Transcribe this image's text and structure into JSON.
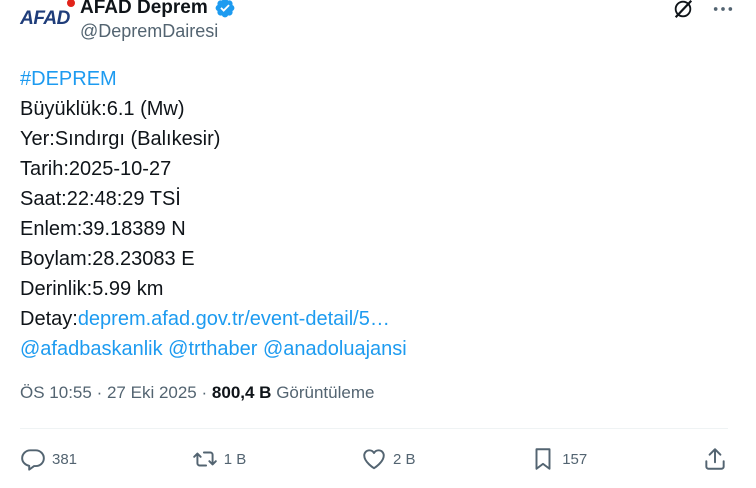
{
  "header": {
    "logo_text": "AFAD",
    "display_name": "AFAD Deprem",
    "handle": "@DepremDairesi"
  },
  "content": {
    "hashtag": "#DEPREM",
    "lines": [
      "Büyüklük:6.1 (Mw)",
      "Yer:Sındırgı (Balıkesir)",
      "Tarih:2025-10-27",
      "Saat:22:48:29 TSİ",
      "Enlem:39.18389 N",
      "Boylam:28.23083 E",
      "Derinlik:5.99 km"
    ],
    "detail_label": "Detay:",
    "detail_link": "deprem.afad.gov.tr/event-detail/5…",
    "mentions": [
      "@afadbaskanlik",
      "@trthaber",
      "@anadoluajansi"
    ]
  },
  "meta": {
    "time": "ÖS 10:55",
    "date": "27 Eki 2025",
    "views_count": "800,4 B",
    "views_label": "Görüntüleme",
    "separator": "·"
  },
  "actions": {
    "replies": "381",
    "reposts": "1 B",
    "likes": "2 B",
    "bookmarks": "157"
  },
  "colors": {
    "accent": "#1d9bf0",
    "text": "#0f1419",
    "muted": "#536471",
    "logo_blue": "#1f3d7a",
    "logo_red": "#e2231a"
  }
}
